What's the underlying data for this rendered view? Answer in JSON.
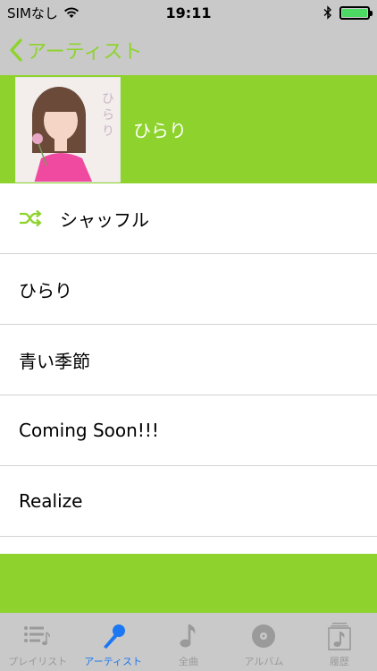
{
  "status": {
    "carrier": "SIMなし",
    "time": "19:11"
  },
  "nav": {
    "back_label": "アーティスト"
  },
  "header": {
    "title": "ひらり"
  },
  "tracks": [
    {
      "label": "シャッフル",
      "icon": "shuffle-icon"
    },
    {
      "label": "ひらり"
    },
    {
      "label": "青い季節"
    },
    {
      "label": "Coming Soon!!!"
    },
    {
      "label": "Realize"
    }
  ],
  "tabs": [
    {
      "label": "プレイリスト",
      "icon": "playlist-icon"
    },
    {
      "label": "アーティスト",
      "icon": "microphone-icon",
      "active": true
    },
    {
      "label": "全曲",
      "icon": "music-note-icon"
    },
    {
      "label": "アルバム",
      "icon": "disc-icon"
    },
    {
      "label": "履歴",
      "icon": "history-icon"
    }
  ],
  "colors": {
    "accent": "#8ed32d",
    "bars": "#c9c9c9",
    "active_tab": "#1b78f2",
    "battery": "#4cd964"
  }
}
